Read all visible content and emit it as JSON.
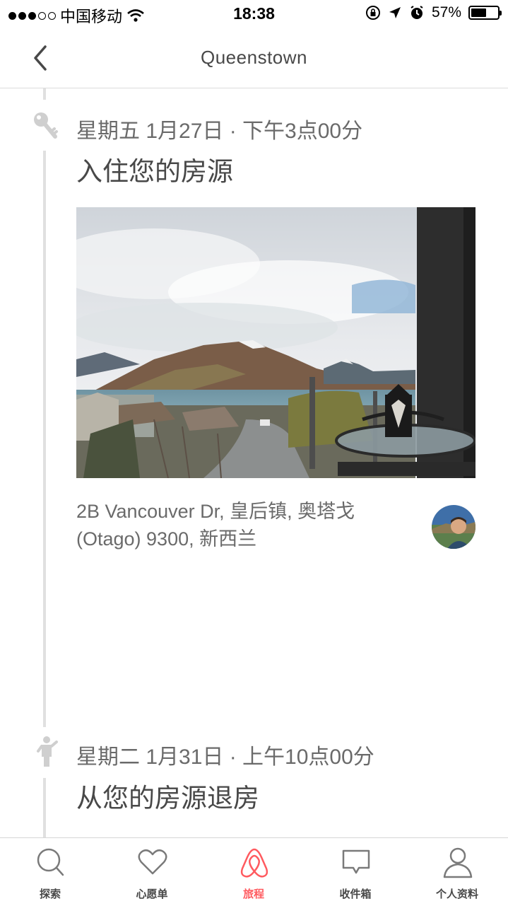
{
  "status_bar": {
    "carrier": "中国移动",
    "time": "18:38",
    "battery": "57%",
    "battery_level": 0.57
  },
  "nav": {
    "title": "Queenstown",
    "back_icon": "chevron-left-icon"
  },
  "events": [
    {
      "icon": "key-icon",
      "date": "星期五 1月27日 · 下午3点00分",
      "title": "入住您的房源"
    },
    {
      "icon": "person-leaving-icon",
      "date": "星期二 1月31日 · 上午10点00分",
      "title": "从您的房源退房"
    }
  ],
  "listing": {
    "address": "2B Vancouver Dr, 皇后镇, 奥塔戈 (Otago) 9300, 新西兰"
  },
  "tabs": [
    {
      "label": "探索",
      "icon": "search-icon"
    },
    {
      "label": "心愿单",
      "icon": "heart-icon"
    },
    {
      "label": "旅程",
      "icon": "airbnb-logo-icon",
      "active": true
    },
    {
      "label": "收件箱",
      "icon": "chat-bubble-icon"
    },
    {
      "label": "个人资料",
      "icon": "profile-icon"
    }
  ],
  "colors": {
    "accent": "#ff5a5f",
    "text": "#484848",
    "muted": "#6a6a6a",
    "timeline": "#e0e0e0"
  }
}
